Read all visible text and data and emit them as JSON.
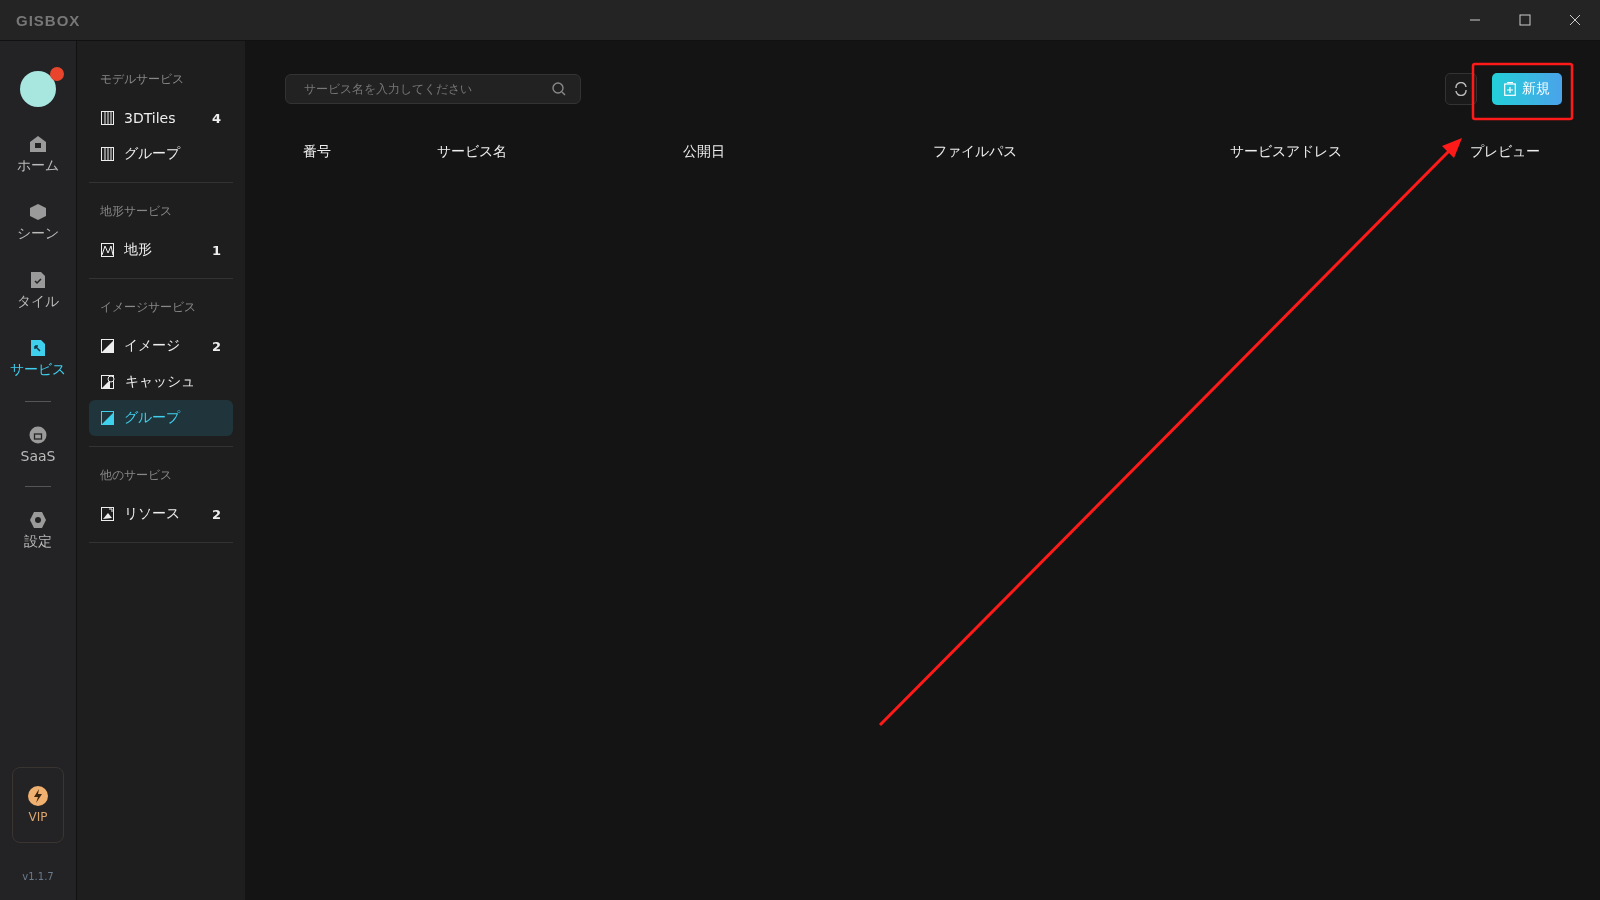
{
  "window": {
    "title": "GISBOX"
  },
  "rail": {
    "items": [
      {
        "kind": "home",
        "label": "ホーム",
        "selected": false
      },
      {
        "kind": "scene",
        "label": "シーン",
        "selected": false
      },
      {
        "kind": "tile",
        "label": "タイル",
        "selected": false
      },
      {
        "kind": "service",
        "label": "サービス",
        "selected": true
      },
      {
        "kind": "divider"
      },
      {
        "kind": "saas",
        "label": "SaaS",
        "selected": false
      },
      {
        "kind": "divider"
      },
      {
        "kind": "settings",
        "label": "設定",
        "selected": false
      }
    ],
    "vip": "VIP",
    "version": "v1.1.7"
  },
  "sidebar": {
    "sections": [
      {
        "title": "モデルサービス",
        "items": [
          {
            "label": "3DTiles",
            "count": "4",
            "kind": "model",
            "selected": false
          },
          {
            "label": "グループ",
            "kind": "model",
            "selected": false
          }
        ]
      },
      {
        "title": "地形サービス",
        "items": [
          {
            "label": "地形",
            "count": "1",
            "kind": "terrain",
            "selected": false
          }
        ]
      },
      {
        "title": "イメージサービス",
        "items": [
          {
            "label": "イメージ",
            "count": "2",
            "kind": "image",
            "selected": false
          },
          {
            "label": "キャッシュ",
            "kind": "cache",
            "selected": false
          },
          {
            "label": "グループ",
            "kind": "image",
            "selected": true
          }
        ]
      },
      {
        "title": "他のサービス",
        "items": [
          {
            "label": "リソース",
            "count": "2",
            "kind": "resource",
            "selected": false
          }
        ]
      }
    ]
  },
  "search": {
    "placeholder": "サービス名を入力してください"
  },
  "new_button": "新規",
  "table": {
    "columns": [
      "番号",
      "サービス名",
      "公開日",
      "ファイルパス",
      "サービスアドレス",
      "プレビュー"
    ]
  }
}
